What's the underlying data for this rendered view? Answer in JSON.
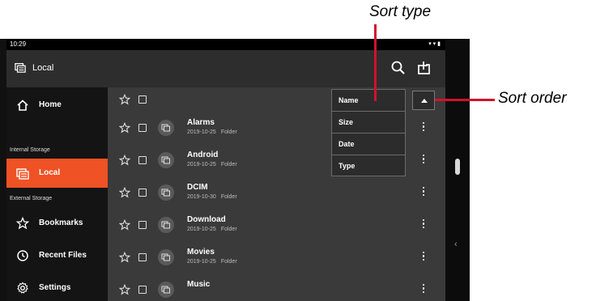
{
  "status": {
    "time": "10:29"
  },
  "appbar": {
    "title": "Local",
    "icons": [
      "local-storage-icon",
      "search-icon",
      "add-folder-icon"
    ]
  },
  "sidebar": {
    "home": "Home",
    "internal_section": "Internal Storage",
    "local": "Local",
    "external_section": "External Storage",
    "bookmarks": "Bookmarks",
    "recent": "Recent Files",
    "settings": "Settings"
  },
  "files": [
    {
      "name": "Alarms",
      "date": "2019-10-25",
      "kind": "Folder"
    },
    {
      "name": "Android",
      "date": "2019-10-25",
      "kind": "Folder"
    },
    {
      "name": "DCIM",
      "date": "2019-10-30",
      "kind": "Folder"
    },
    {
      "name": "Download",
      "date": "2019-10-25",
      "kind": "Folder"
    },
    {
      "name": "Movies",
      "date": "2019-10-25",
      "kind": "Folder"
    },
    {
      "name": "Music",
      "date": "",
      "kind": ""
    }
  ],
  "sort": {
    "options": [
      "Name",
      "Size",
      "Date",
      "Type"
    ]
  },
  "callouts": {
    "sort_type": "Sort type",
    "sort_order": "Sort order"
  },
  "colors": {
    "accent": "#ef5224",
    "callout": "#d3102d"
  }
}
